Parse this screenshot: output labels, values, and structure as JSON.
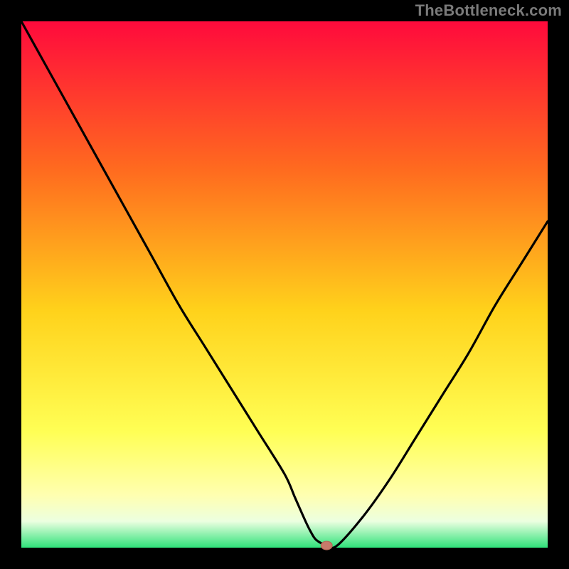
{
  "watermark": "TheBottleneck.com",
  "colors": {
    "black": "#000000",
    "curve": "#000000",
    "marker_fill": "#c77a6a",
    "marker_stroke": "#b36452",
    "gradient_top": "#ff0a3c",
    "gradient_mid_upper": "#ff7a1f",
    "gradient_mid": "#ffd21b",
    "gradient_lower": "#ffff6a",
    "gradient_pale": "#f8ffe0",
    "gradient_green": "#2fe27a"
  },
  "plot": {
    "inner_x": 30,
    "inner_y": 30,
    "inner_w": 740,
    "inner_h": 740
  },
  "chart_data": {
    "type": "line",
    "title": "",
    "xlabel": "",
    "ylabel": "",
    "xlim": [
      0,
      100
    ],
    "ylim": [
      0,
      100
    ],
    "series": [
      {
        "name": "bottleneck-curve",
        "x": [
          0,
          5,
          10,
          15,
          20,
          25,
          30,
          35,
          40,
          45,
          50,
          52,
          54,
          55,
          56,
          58,
          60,
          65,
          70,
          75,
          80,
          85,
          90,
          95,
          100
        ],
        "values": [
          100,
          91,
          82,
          73,
          64,
          55,
          46,
          38,
          30,
          22,
          14,
          9.5,
          5,
          3,
          1.5,
          0.4,
          0.4,
          6,
          13,
          21,
          29,
          37,
          46,
          54,
          62
        ]
      }
    ],
    "minimum_marker": {
      "x": 58,
      "y": 0.4
    }
  }
}
